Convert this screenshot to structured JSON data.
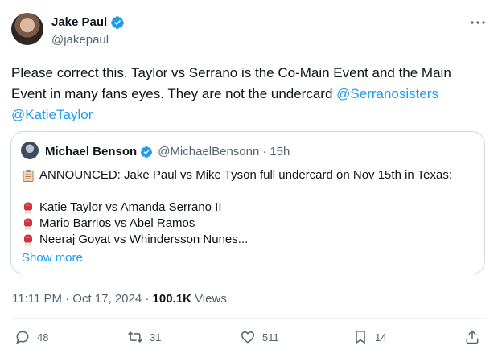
{
  "post": {
    "author": {
      "name": "Jake Paul",
      "handle": "@jakepaul",
      "verified": true
    },
    "text_parts": {
      "plain": "Please correct this. Taylor vs Serrano is the Co-Main Event and the Main Event in many fans eyes. They are not the undercard ",
      "mention1": "@Serranosisters",
      "mention2": "@KatieTaylor"
    },
    "quote": {
      "author_name": "Michael Benson",
      "handle": "@MichaelBensonn",
      "separator": "·",
      "time": "15h",
      "announce_line": "ANNOUNCED: Jake Paul vs Mike Tyson full undercard on Nov 15th in Texas:",
      "fights": [
        "Katie Taylor vs Amanda Serrano II",
        "Mario Barrios vs Abel Ramos",
        "Neeraj Goyat vs Whindersson Nunes..."
      ],
      "show_more": "Show more"
    },
    "meta": {
      "time_date": "11:11 PM · Oct 17, 2024 · ",
      "views_count": "100.1K",
      "views_label": " Views"
    },
    "actions": {
      "replies": "48",
      "reposts": "31",
      "likes": "511",
      "bookmarks": "14"
    }
  },
  "colors": {
    "accent": "#1d9bf0",
    "muted": "#536471",
    "text": "#0f1419",
    "border": "#cfd9de",
    "glove": "#d0313b"
  }
}
